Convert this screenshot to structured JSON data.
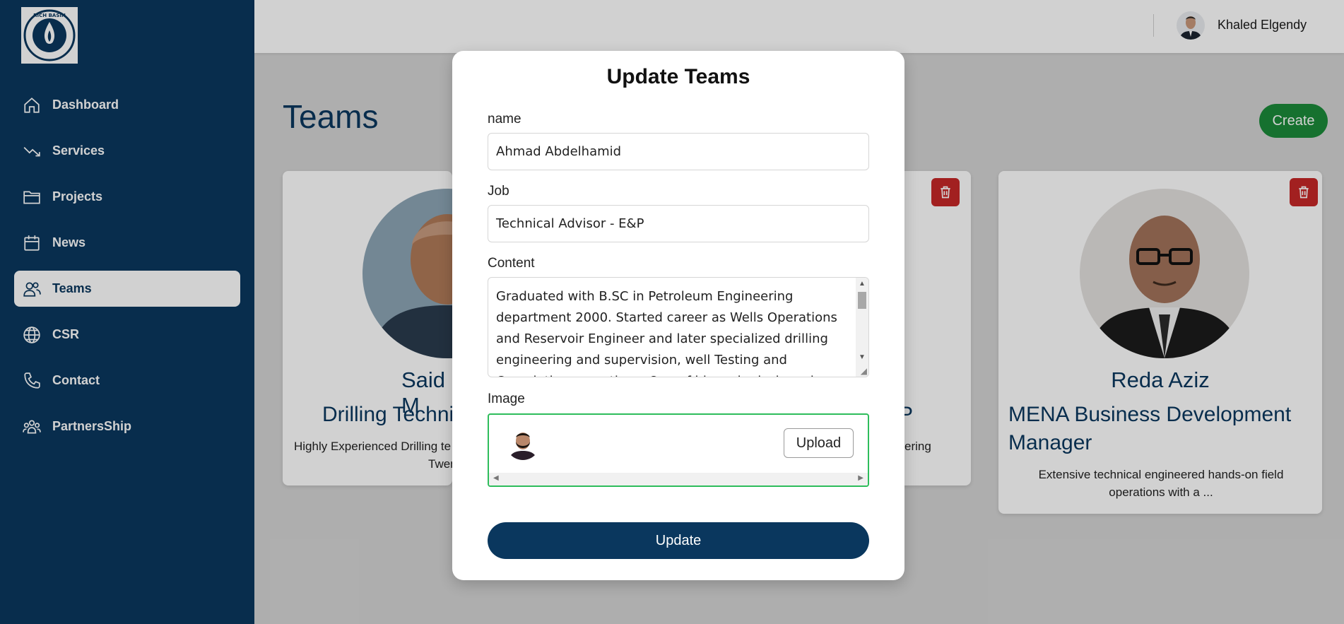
{
  "brand": {
    "logo_text": "RICH BASIN"
  },
  "sidebar": {
    "items": [
      {
        "label": "Dashboard",
        "icon": "home-icon"
      },
      {
        "label": "Services",
        "icon": "trend-down-icon"
      },
      {
        "label": "Projects",
        "icon": "folder-icon"
      },
      {
        "label": "News",
        "icon": "calendar-icon"
      },
      {
        "label": "Teams",
        "icon": "users-icon",
        "active": true
      },
      {
        "label": "CSR",
        "icon": "globe-icon"
      },
      {
        "label": "Contact",
        "icon": "phone-icon"
      },
      {
        "label": "PartnersShip",
        "icon": "group-icon"
      }
    ]
  },
  "topbar": {
    "user_name": "Khaled Elgendy"
  },
  "page": {
    "title": "Teams",
    "create_label": "Create",
    "cards": [
      {
        "name": "Said M",
        "job": "Drilling Techni",
        "desc_line1": "Highly Experienced Drilling te",
        "desc_line2": "Twen"
      },
      {
        "name": "",
        "job": "P",
        "desc_line1": "ering",
        "desc_line2": ""
      },
      {
        "name": "Reda Aziz",
        "job": "MENA Business Development Manager",
        "desc": "Extensive technical engineered hands-on field operations with a ..."
      }
    ]
  },
  "modal": {
    "title": "Update Teams",
    "name_label": "name",
    "name_value": "Ahmad Abdelhamid",
    "job_label": "Job",
    "job_value": "Technical Advisor - E&P",
    "content_label": "Content",
    "content_value": "Graduated with B.SC in Petroleum Engineering department 2000. Started career as Wells Operations and Reservoir Engineer and later specialized drilling engineering and supervision, well Testing and Completion operations. One of his main desk works",
    "image_label": "Image",
    "upload_label": "Upload",
    "submit_label": "Update"
  },
  "colors": {
    "primary": "#0a375e",
    "create": "#1c8a3a",
    "delete": "#c62828",
    "focus": "#2ebd5b"
  }
}
